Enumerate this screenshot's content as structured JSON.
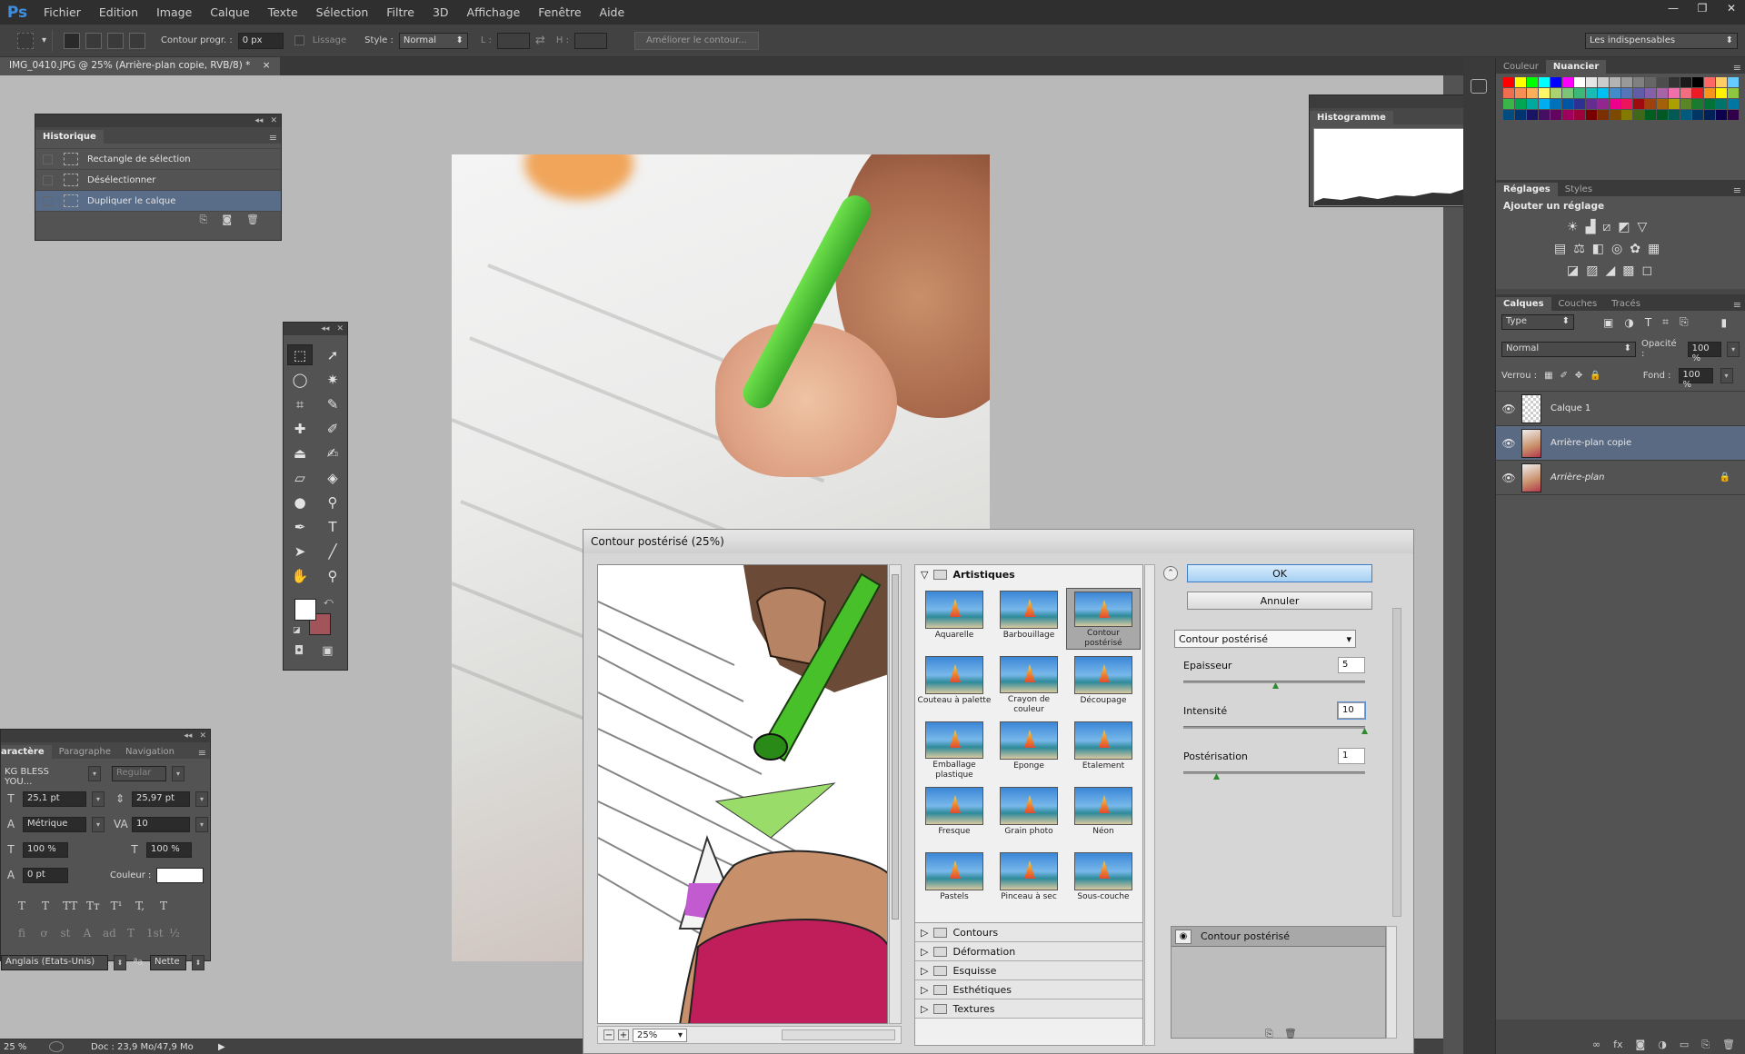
{
  "app": {
    "logo": "Ps",
    "menu": [
      "Fichier",
      "Edition",
      "Image",
      "Calque",
      "Texte",
      "Sélection",
      "Filtre",
      "3D",
      "Affichage",
      "Fenêtre",
      "Aide"
    ]
  },
  "options_bar": {
    "feather_label": "Contour progr. :",
    "feather_value": "0 px",
    "smoothing_label": "Lissage",
    "style_label": "Style :",
    "style_value": "Normal",
    "width_label": "L :",
    "height_label": "H :",
    "refine_edge_label": "Améliorer le contour...",
    "workspace": "Les indispensables"
  },
  "document": {
    "tab_title": "IMG_0410.JPG @ 25% (Arrière-plan copie, RVB/8) *",
    "zoom": "25 %",
    "doc_info": "Doc : 23,9 Mo/47,9 Mo"
  },
  "history": {
    "title": "Historique",
    "items": [
      {
        "label": "Rectangle de sélection",
        "selected": false
      },
      {
        "label": "Désélectionner",
        "selected": false
      },
      {
        "label": "Dupliquer le calque",
        "selected": true
      }
    ]
  },
  "character": {
    "tabs": [
      "aractère",
      "Paragraphe",
      "Navigation"
    ],
    "font_family": "KG BLESS YOU...",
    "font_style": "Regular",
    "font_size": "25,1 pt",
    "leading": "25,97 pt",
    "kerning": "Métrique",
    "tracking": "10",
    "vscale": "100 %",
    "hscale": "100 %",
    "baseline": "0 pt",
    "color_label": "Couleur :",
    "language": "Anglais (Etats-Unis)",
    "antialias": "Nette",
    "type_buttons": [
      "T",
      "T",
      "TT",
      "Tт",
      "T¹",
      "T,",
      "T"
    ],
    "opentype_buttons": [
      "fi",
      "ơ",
      "st",
      "A",
      "ad",
      "T",
      "1st",
      "½"
    ]
  },
  "histogram": {
    "title": "Histogramme"
  },
  "right_dock": {
    "color_tabs": [
      "Couleur",
      "Nuancier"
    ],
    "adjust_tabs": [
      "Réglages",
      "Styles"
    ],
    "adjust_title": "Ajouter un réglage",
    "layer_tabs": [
      "Calques",
      "Couches",
      "Tracés"
    ],
    "filter_kind": "Type",
    "blend_mode": "Normal",
    "opacity_label": "Opacité :",
    "opacity_value": "100 %",
    "lock_label": "Verrou :",
    "fill_label": "Fond :",
    "fill_value": "100 %",
    "layers": [
      {
        "name": "Calque 1",
        "selected": false,
        "locked": false
      },
      {
        "name": "Arrière-plan copie",
        "selected": true,
        "locked": false
      },
      {
        "name": "Arrière-plan",
        "selected": false,
        "locked": true
      }
    ],
    "swatch_colors": [
      "#ff0000",
      "#ffff00",
      "#00ff00",
      "#00ffff",
      "#0000ff",
      "#ff00ff",
      "#ffffff",
      "#e6e6e6",
      "#cccccc",
      "#b3b3b3",
      "#999999",
      "#808080",
      "#666666",
      "#4d4d4d",
      "#333333",
      "#1a1a1a",
      "#000000",
      "#ff6666",
      "#ffcc66",
      "#66ccff",
      "#f26c4f",
      "#f68e56",
      "#fbaf5d",
      "#fff568",
      "#acd372",
      "#7cc576",
      "#3bb878",
      "#1abbb4",
      "#00bff3",
      "#438ccb",
      "#5574b9",
      "#605ca8",
      "#855fa8",
      "#a763a8",
      "#f06ea9",
      "#f26d7d",
      "#ed1c24",
      "#f7941d",
      "#fff200",
      "#8dc63f",
      "#39b54a",
      "#00a651",
      "#00a99d",
      "#00aeef",
      "#0072bc",
      "#0054a6",
      "#2e3192",
      "#662d91",
      "#92278f",
      "#ec008c",
      "#ed145b",
      "#9e0b0f",
      "#a0410d",
      "#a36209",
      "#aba000",
      "#598527",
      "#1a7b30",
      "#007236",
      "#00746b",
      "#0076a3",
      "#004b80",
      "#003471",
      "#1b1464",
      "#440e62",
      "#630460",
      "#9e005d",
      "#9e0039",
      "#790000",
      "#7b2e00",
      "#7d4900",
      "#827b00",
      "#406618",
      "#005e20",
      "#005826",
      "#005952",
      "#005b7f",
      "#003663",
      "#002157",
      "#0d004c",
      "#32004b"
    ]
  },
  "filter_dialog": {
    "title": "Contour postérisé (25%)",
    "zoom": "25%",
    "ok_label": "OK",
    "cancel_label": "Annuler",
    "selected_filter": "Contour postérisé",
    "params": [
      {
        "label": "Epaisseur",
        "value": "5",
        "fraction": 0.5
      },
      {
        "label": "Intensité",
        "value": "10",
        "fraction": 1.0
      },
      {
        "label": "Postérisation",
        "value": "1",
        "fraction": 0.17
      }
    ],
    "open_category": "Artistiques",
    "filters": [
      {
        "label": "Aquarelle",
        "selected": false
      },
      {
        "label": "Barbouillage",
        "selected": false
      },
      {
        "label": "Contour postérisé",
        "selected": true
      },
      {
        "label": "Couteau à palette",
        "selected": false
      },
      {
        "label": "Crayon de couleur",
        "selected": false
      },
      {
        "label": "Découpage",
        "selected": false
      },
      {
        "label": "Emballage plastique",
        "selected": false
      },
      {
        "label": "Eponge",
        "selected": false
      },
      {
        "label": "Etalement",
        "selected": false
      },
      {
        "label": "Fresque",
        "selected": false
      },
      {
        "label": "Grain photo",
        "selected": false
      },
      {
        "label": "Néon",
        "selected": false
      },
      {
        "label": "Pastels",
        "selected": false
      },
      {
        "label": "Pinceau à sec",
        "selected": false
      },
      {
        "label": "Sous-couche",
        "selected": false
      }
    ],
    "categories": [
      "Contours",
      "Déformation",
      "Esquisse",
      "Esthétiques",
      "Textures"
    ],
    "effect_layer": "Contour postérisé"
  }
}
